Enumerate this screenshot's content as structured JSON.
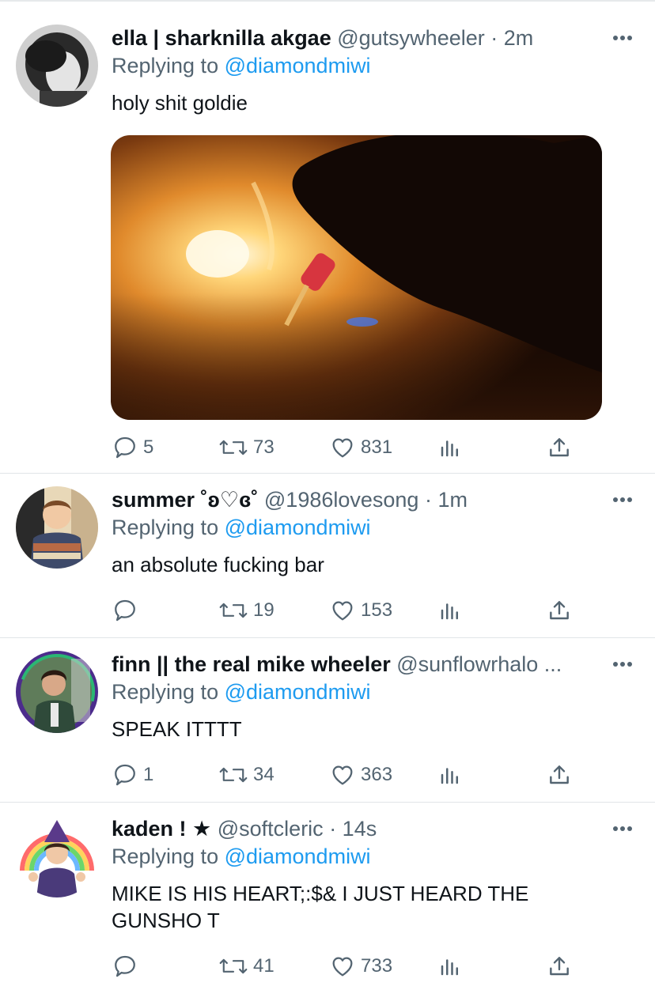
{
  "tweets": [
    {
      "name": "ella | sharknilla akgae",
      "handle": "@gutsywheeler",
      "meta": " · 2m",
      "replying_prefix": "Replying to ",
      "replying_to": "@diamondmiwi",
      "text": "holy shit goldie",
      "has_media": true,
      "replies": "5",
      "retweets": "73",
      "likes": "831"
    },
    {
      "name": "summer ˚ʚ♡ɞ˚",
      "handle": "@1986lovesong",
      "meta": " · 1m",
      "replying_prefix": "Replying to ",
      "replying_to": "@diamondmiwi",
      "text": "an absolute fucking bar",
      "has_media": false,
      "replies": "",
      "retweets": "19",
      "likes": "153"
    },
    {
      "name": "finn || the real mike wheeler",
      "handle": "@sunflowrhalo ...",
      "meta": "",
      "replying_prefix": "Replying to ",
      "replying_to": "@diamondmiwi",
      "text": "SPEAK ITTTT",
      "has_media": false,
      "replies": "1",
      "retweets": "34",
      "likes": "363"
    },
    {
      "name": "kaden ! ★",
      "handle": "@softcleric",
      "meta": " · 14s",
      "replying_prefix": "Replying to ",
      "replying_to": "@diamondmiwi",
      "text": "MIKE IS HIS HEART;:$& I JUST HEARD THE GUNSHO T",
      "has_media": false,
      "replies": "",
      "retweets": "41",
      "likes": "733"
    }
  ],
  "icons": {
    "reply": "reply-icon",
    "retweet": "retweet-icon",
    "like": "heart-icon",
    "analytics": "analytics-icon",
    "share": "share-icon",
    "more": "more-icon"
  },
  "colors": {
    "link": "#1d9bf0",
    "secondary_text": "#536471",
    "primary_text": "#0f1419",
    "divider": "#e1e5e8"
  }
}
